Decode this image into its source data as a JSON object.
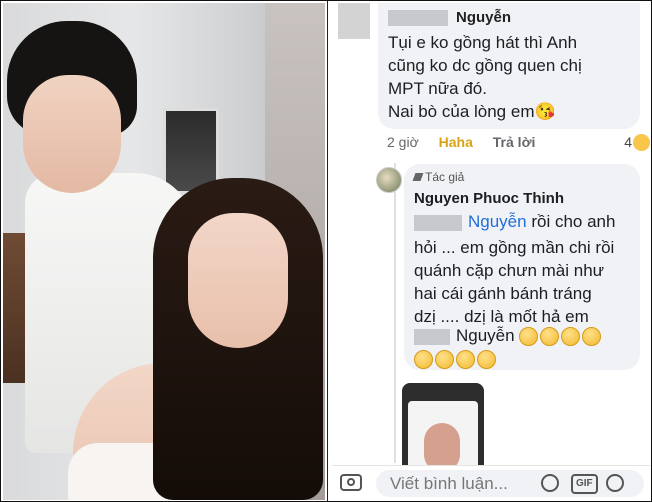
{
  "photo": {
    "alt": "couple selfie"
  },
  "comment1": {
    "author": "Nguyễn",
    "text": "Tụi e ko gồng hát thì Anh\ncũng ko dc gồng quen chị\nMPT nữa đó.\nNai bò của lòng em😘",
    "time": "2 giờ",
    "reaction_label": "Haha",
    "reply_label": "Trả lời",
    "reaction_count": "4"
  },
  "comment2": {
    "badge": "Tác giả",
    "author": "Nguyen Phuoc Thinh",
    "mention1": "Nguyễn",
    "line1_tail": "rồi cho anh",
    "text": "hỏi ... em gồng mần chi rồi\nquánh cặp chưn mài như\nhai cái gánh bánh tráng\ndzị .... dzị là mốt hả em",
    "mention2": "Nguyễn"
  },
  "composer": {
    "placeholder": "Viết bình luận...",
    "gif_label": "GIF"
  }
}
